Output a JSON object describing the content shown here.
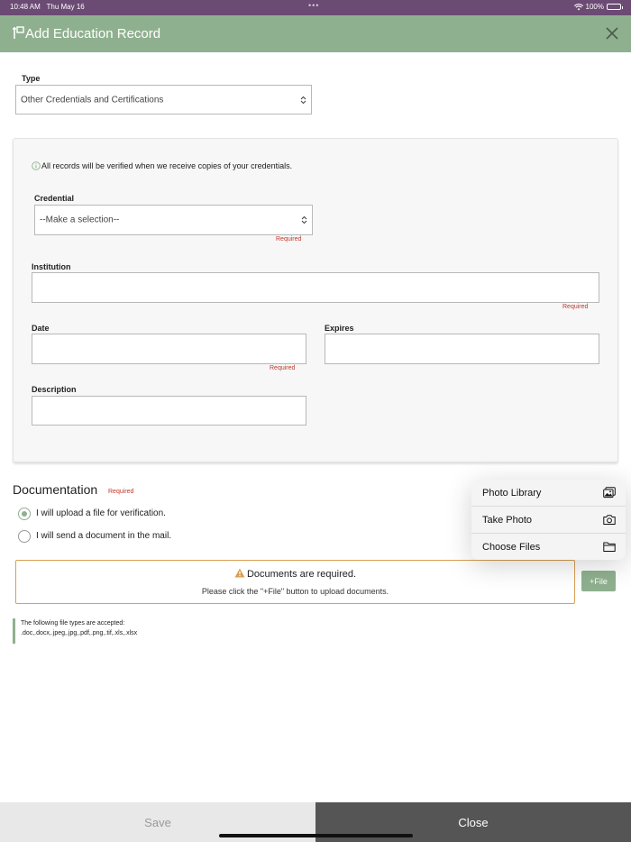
{
  "status_bar": {
    "time": "10:48 AM",
    "date": "Thu May 16",
    "dots": "•••",
    "battery": "100%"
  },
  "header": {
    "title": "Add Education Record",
    "background": "#8fb08f"
  },
  "form": {
    "type_label": "Type",
    "type_value": "Other Credentials and Certifications",
    "info_text": "All records will be verified when we receive copies of your credentials.",
    "credential_label": "Credential",
    "credential_value": "--Make a selection--",
    "credential_required": "Required",
    "institution_label": "Institution",
    "institution_required": "Required",
    "date_label": "Date",
    "date_required": "Required",
    "expires_label": "Expires",
    "description_label": "Description"
  },
  "documentation": {
    "title": "Documentation",
    "required": "Required",
    "options": [
      {
        "label": "I will upload a file for verification.",
        "selected": true
      },
      {
        "label": "I will send a document in the mail.",
        "selected": false
      }
    ],
    "warning_title": "Documents are required.",
    "warning_text": "Please click the \"+File\" button to upload documents.",
    "file_button": "+File",
    "accepted_title": "The following file types are accepted:",
    "accepted_types": ".doc,.docx,.jpeg,.jpg,.pdf,.png,.tif,.xls,.xlsx"
  },
  "popover": {
    "items": [
      {
        "label": "Photo Library",
        "icon": "photo-library-icon"
      },
      {
        "label": "Take Photo",
        "icon": "camera-icon"
      },
      {
        "label": "Choose Files",
        "icon": "folder-icon"
      }
    ]
  },
  "footer": {
    "save_label": "Save",
    "close_label": "Close"
  },
  "colors": {
    "accent": "#8fb08f",
    "status_bar": "#6b4a74",
    "warning_border": "#d9a054",
    "required": "#c0392b"
  }
}
